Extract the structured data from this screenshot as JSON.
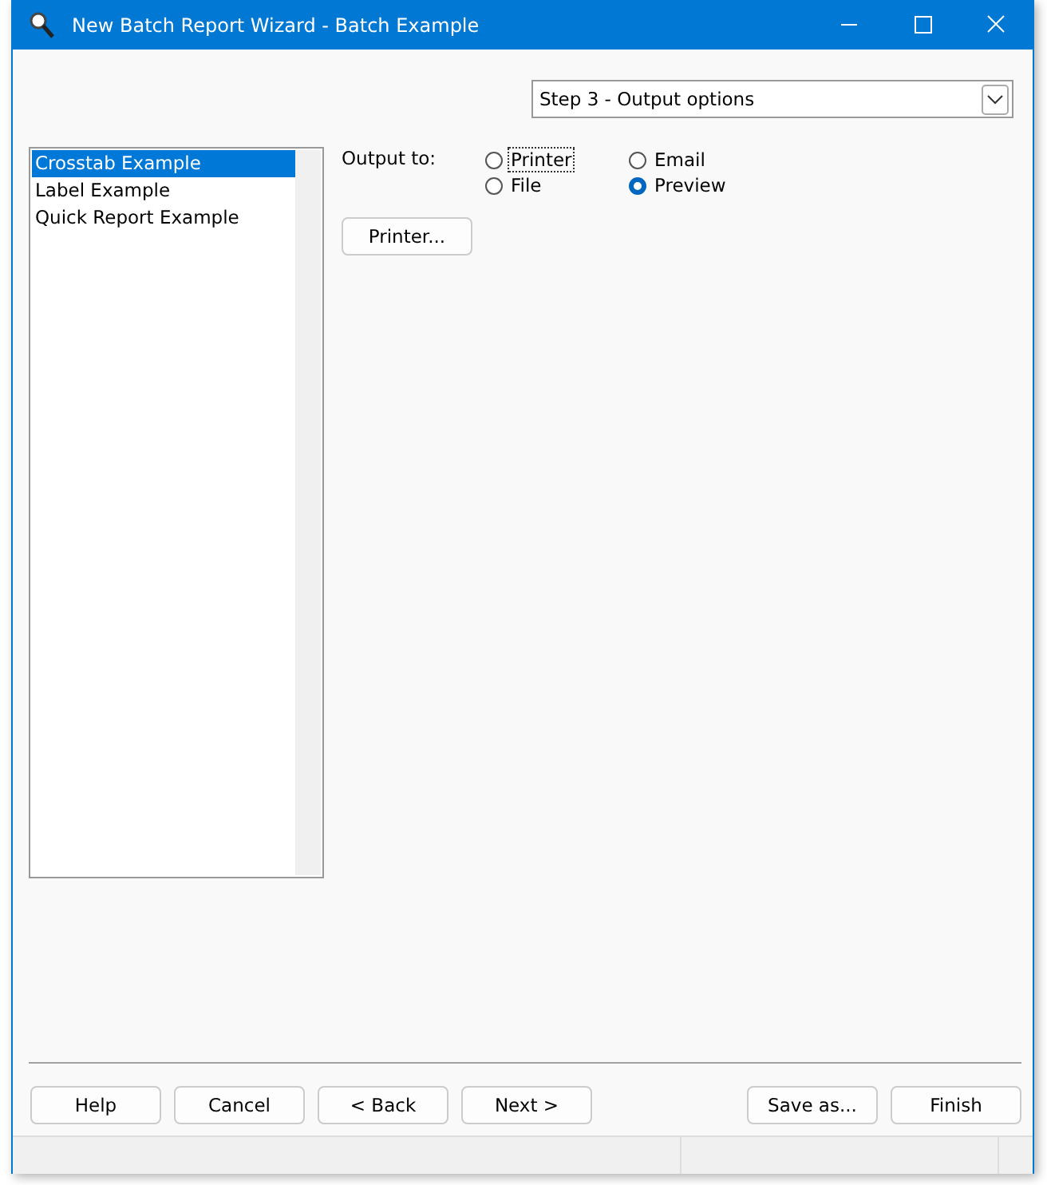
{
  "window": {
    "title": "New Batch Report Wizard - Batch Example"
  },
  "step_select": {
    "value": "Step 3 - Output options"
  },
  "reports": [
    {
      "label": "Crosstab Example",
      "selected": true
    },
    {
      "label": "Label Example",
      "selected": false
    },
    {
      "label": "Quick Report Example",
      "selected": false
    }
  ],
  "output": {
    "label": "Output to:",
    "options": [
      {
        "label": "Printer",
        "selected": false,
        "focused": true
      },
      {
        "label": "File",
        "selected": false,
        "focused": false
      },
      {
        "label": "Email",
        "selected": false,
        "focused": false
      },
      {
        "label": "Preview",
        "selected": true,
        "focused": false
      }
    ],
    "printer_button": "Printer..."
  },
  "buttons_left": [
    "Help",
    "Cancel",
    "< Back",
    "Next >"
  ],
  "buttons_right": [
    "Save as...",
    "Finish"
  ]
}
